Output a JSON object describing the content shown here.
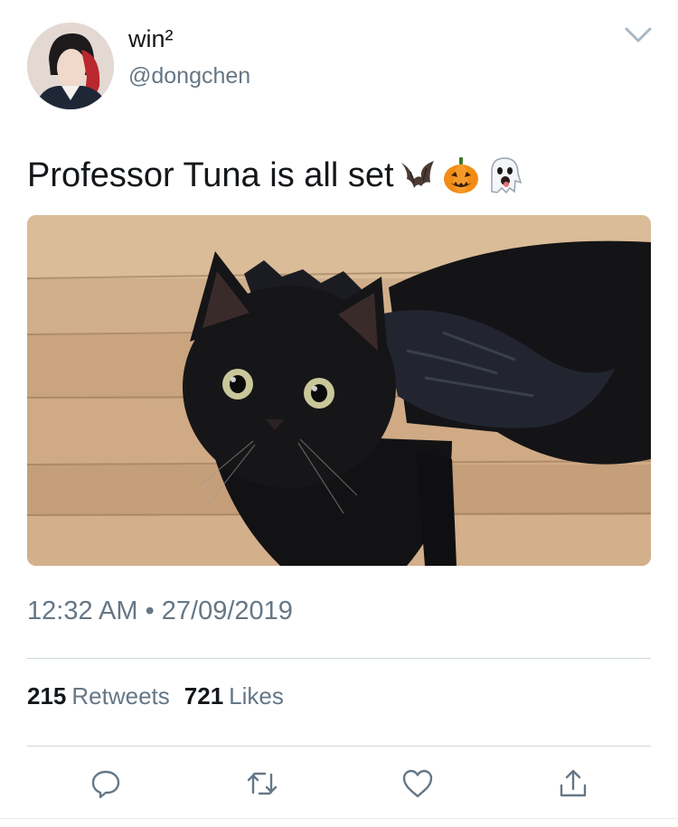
{
  "user": {
    "display_name": "win²",
    "handle": "@dongchen"
  },
  "tweet": {
    "text": "Professor Tuna is all set",
    "emojis": [
      "bat-emoji",
      "jack-o-lantern-emoji",
      "ghost-emoji"
    ],
    "media_description_icon": "photo",
    "timestamp": "12:32 AM • 27/09/2019"
  },
  "stats": {
    "retweets_count": "215",
    "retweets_label": "Retweets",
    "likes_count": "721",
    "likes_label": "Likes"
  },
  "actions": {
    "icons": [
      "reply-icon",
      "retweet-icon",
      "like-icon",
      "share-icon"
    ]
  },
  "colors": {
    "text": "#14171a",
    "secondary": "#657786",
    "divider": "#ccd6dd"
  }
}
